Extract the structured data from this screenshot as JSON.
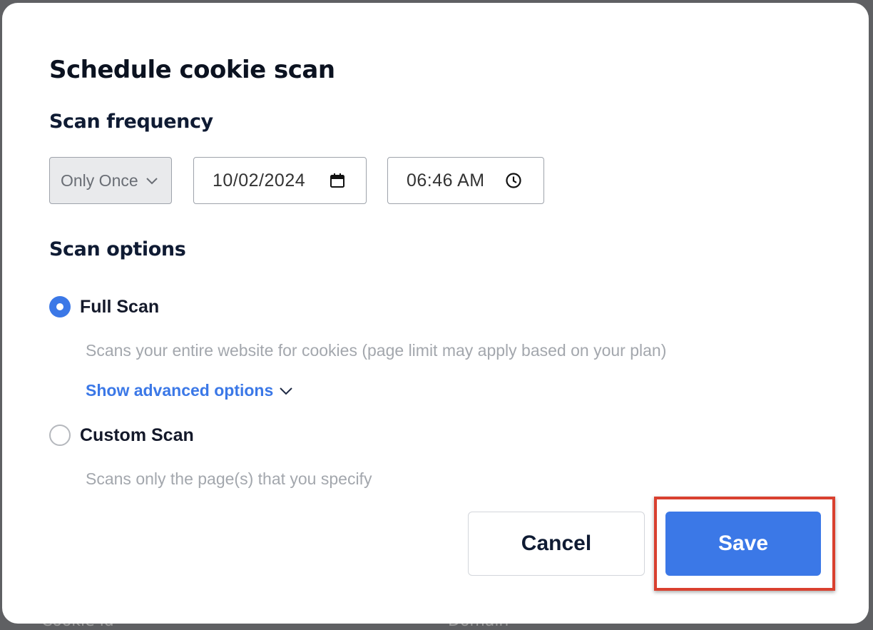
{
  "dialog": {
    "title": "Schedule cookie scan",
    "frequency": {
      "heading": "Scan frequency",
      "repeat_select": {
        "value": "Only Once"
      },
      "date_input": {
        "value": "10/02/2024"
      },
      "time_input": {
        "value": "06:46 AM"
      }
    },
    "options": {
      "heading": "Scan options",
      "full_scan": {
        "label": "Full Scan",
        "selected": true,
        "description": "Scans your entire website for cookies (page limit may apply based on your plan)",
        "advanced_link": "Show advanced options"
      },
      "custom_scan": {
        "label": "Custom Scan",
        "selected": false,
        "description": "Scans only the page(s) that you specify"
      }
    },
    "buttons": {
      "cancel": "Cancel",
      "save": "Save"
    }
  },
  "background": {
    "col1_header": "Cookie id",
    "col2_header": "Domain"
  },
  "colors": {
    "accent": "#3b78e7",
    "highlight": "#d9402f",
    "text_dark": "#0f1b33",
    "muted": "#a3a7ad"
  },
  "icons": [
    "chevron-down-icon",
    "calendar-icon",
    "clock-icon",
    "radio-selected-icon",
    "radio-unselected-icon"
  ]
}
